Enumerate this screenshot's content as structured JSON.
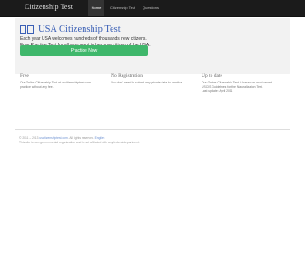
{
  "nav": {
    "brand": "Citizenship Test",
    "items": [
      {
        "label": "Home",
        "active": true
      },
      {
        "label": "Citizenship Test",
        "active": false
      },
      {
        "label": "Questions",
        "active": false
      }
    ]
  },
  "hero": {
    "flag_glyph": "□□",
    "title": "USA Citizenship Test",
    "lead_line1": "Each year USA welcomes hundreds of thousands new citizens.",
    "lead_line2": "Free Practice Test for all who want to become citizen of the USA.",
    "cta_label": "Practice Now"
  },
  "columns": [
    {
      "heading": "Free",
      "line1": "Our Online Citizenship Test at uscitizenshiptest.com —",
      "line2": "practice without any fee."
    },
    {
      "heading": "No Registration",
      "line1": "You don't need to submit any private data to practice.",
      "line2": ""
    },
    {
      "heading": "Up to date",
      "line1": "Our Online Citizenship Test is based on most recent",
      "line2": "USCIS Guidelines for the Naturalization Test.",
      "line3": "Last update: April 2011"
    }
  ],
  "footer": {
    "prefix": "© 2011 – 2013",
    "site_link": "uscitizenshiptest.com",
    "rights": ". All rights reserved.",
    "lang_link": "English",
    "disclaimer": "This site is non-governmental organization and is not affiliated with any federal department."
  },
  "colors": {
    "navbar": "#1b1b1b",
    "accent_blue": "#3a5fb5",
    "cta_green": "#3fb76b",
    "hero_bg": "#f2f2f2"
  }
}
